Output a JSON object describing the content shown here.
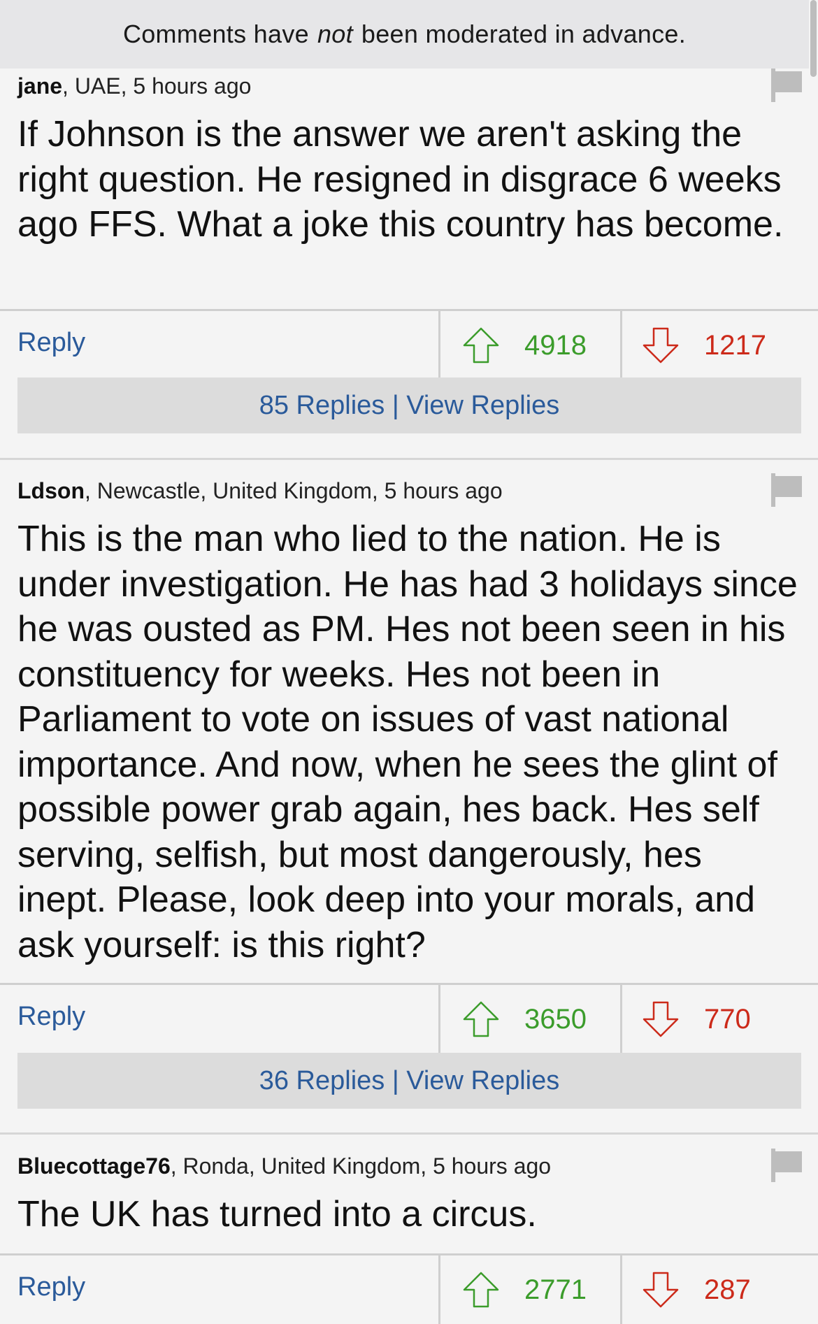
{
  "banner": {
    "pre": "Comments have",
    "emph": "not",
    "post": "been moderated in advance."
  },
  "comments": [
    {
      "user": "jane",
      "location": ", UAE, 5 hours ago",
      "text": "If Johnson is the answer we aren't asking the right question. He resigned in disgrace 6 weeks ago FFS. What a joke this country has become.",
      "reply_label": "Reply",
      "upvotes": "4918",
      "downvotes": "1217",
      "replies_label": "85 Replies | View Replies"
    },
    {
      "user": "Ldson",
      "location": ", Newcastle, United Kingdom, 5 hours ago",
      "text": "This is the man who lied to the nation. He is under investigation. He has had 3 holidays since he was ousted as PM. Hes not been seen in his constituency for weeks. Hes not been in Parliament to vote on issues of vast national importance. And now, when he sees the glint of possible power grab again, hes back. Hes self serving, selfish, but most dangerously, hes inept. Please, look deep into your morals, and ask yourself: is this right?",
      "reply_label": "Reply",
      "upvotes": "3650",
      "downvotes": "770",
      "replies_label": "36 Replies | View Replies"
    },
    {
      "user": "Bluecottage76",
      "location": ", Ronda, United Kingdom, 5 hours ago",
      "text": "The UK has turned into a circus.",
      "reply_label": "Reply",
      "upvotes": "2771",
      "downvotes": "287"
    }
  ],
  "icons": {
    "flag": "flag-icon",
    "up": "arrow-up-icon",
    "down": "arrow-down-icon"
  },
  "colors": {
    "link": "#2a5a9a",
    "upvote": "#3b9c2b",
    "downvote": "#cc2a1a"
  }
}
